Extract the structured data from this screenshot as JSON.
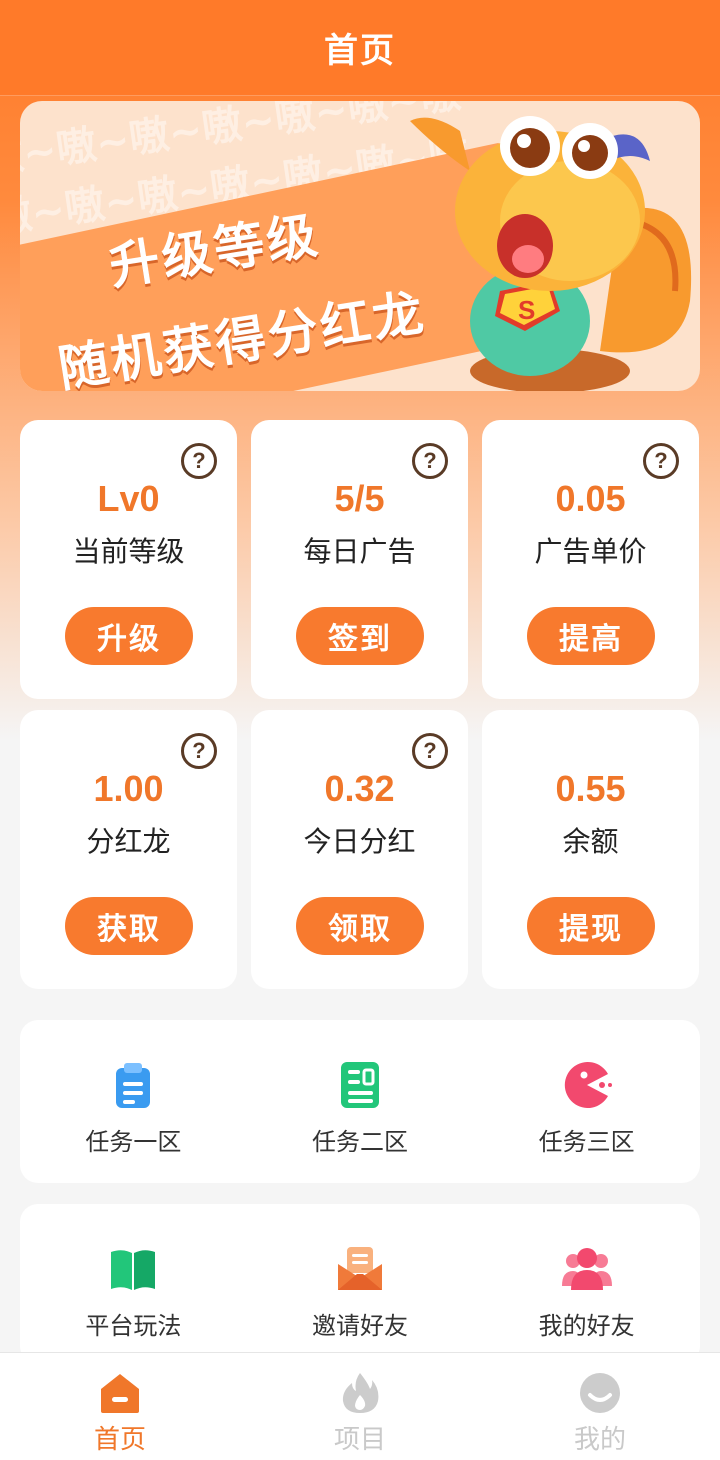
{
  "header": {
    "title": "首页"
  },
  "banner": {
    "line1": "升级等级",
    "line2": "随机获得分红龙",
    "bg_text": "嗷~嗷~嗷~嗷~嗷~嗷~嗷~嗷~嗷~嗷~嗷~嗷~嗷~嗷~嗷~嗷~嗷~嗷~嗷~嗷~嗷~嗷~嗷~嗷~嗷~嗷~嗷~嗷~嗷~嗷~嗷~嗷~嗷~嗷~嗷~嗷~",
    "badge": "S",
    "dots": 2,
    "active_dot": 0
  },
  "stats": [
    {
      "value": "Lv0",
      "label": "当前等级",
      "button": "升级",
      "help": "?"
    },
    {
      "value": "5/5",
      "label": "每日广告",
      "button": "签到",
      "help": "?"
    },
    {
      "value": "0.05",
      "label": "广告单价",
      "button": "提高",
      "help": "?"
    },
    {
      "value": "1.00",
      "label": "分红龙",
      "button": "获取",
      "help": "?"
    },
    {
      "value": "0.32",
      "label": "今日分红",
      "button": "领取",
      "help": "?"
    },
    {
      "value": "0.55",
      "label": "余额",
      "button": "提现"
    }
  ],
  "tasks": [
    {
      "label": "任务一区",
      "icon": "clipboard-icon",
      "color": "#3a9bf0"
    },
    {
      "label": "任务二区",
      "icon": "document-icon",
      "color": "#22c67a"
    },
    {
      "label": "任务三区",
      "icon": "pacman-icon",
      "color": "#f2496e"
    }
  ],
  "tools": [
    {
      "label": "平台玩法",
      "icon": "book-icon",
      "color": "#22c67a"
    },
    {
      "label": "邀请好友",
      "icon": "envelope-icon",
      "color": "#f07a3a"
    },
    {
      "label": "我的好友",
      "icon": "friends-icon",
      "color": "#f2496e"
    }
  ],
  "nav": [
    {
      "label": "首页",
      "icon": "home-icon",
      "active": true
    },
    {
      "label": "项目",
      "icon": "flame-icon",
      "active": false
    },
    {
      "label": "我的",
      "icon": "smile-icon",
      "active": false
    }
  ],
  "colors": {
    "primary": "#ff7a29",
    "accent_text": "#f0772a",
    "help_icon": "#5a3b26"
  }
}
